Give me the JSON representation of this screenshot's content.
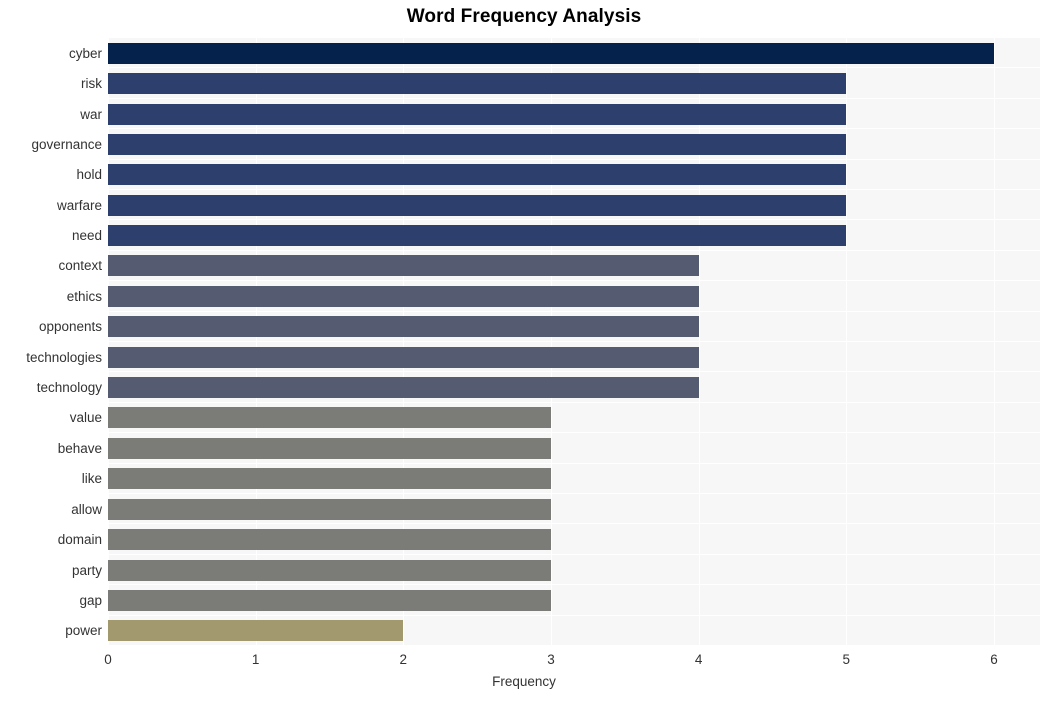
{
  "chart_data": {
    "type": "bar",
    "orientation": "horizontal",
    "title": "Word Frequency Analysis",
    "xlabel": "Frequency",
    "ylabel": "",
    "categories": [
      "cyber",
      "risk",
      "war",
      "governance",
      "hold",
      "warfare",
      "need",
      "context",
      "ethics",
      "opponents",
      "technologies",
      "technology",
      "value",
      "behave",
      "like",
      "allow",
      "domain",
      "party",
      "gap",
      "power"
    ],
    "values": [
      6,
      5,
      5,
      5,
      5,
      5,
      5,
      4,
      4,
      4,
      4,
      4,
      3,
      3,
      3,
      3,
      3,
      3,
      3,
      2
    ],
    "bar_colors": [
      "#04224c",
      "#2d3f6d",
      "#2d3f6d",
      "#2d3f6d",
      "#2d3f6d",
      "#2d3f6d",
      "#2d3f6d",
      "#555b70",
      "#555b70",
      "#555b70",
      "#555b70",
      "#555b70",
      "#7b7b77",
      "#7b7b77",
      "#7b7b77",
      "#7b7b77",
      "#7b7b77",
      "#7b7b77",
      "#7b7b77",
      "#a3996e"
    ],
    "xlim": [
      0,
      6
    ],
    "xticks": [
      0,
      1,
      2,
      3,
      4,
      5,
      6
    ],
    "xtick_labels": [
      "0",
      "1",
      "2",
      "3",
      "4",
      "5",
      "6"
    ],
    "grid": true,
    "grid_color": "#ffffff",
    "panel_background": "#f7f7f7",
    "legend": null
  },
  "style": {
    "title_color": "#000000",
    "tick_label_color": "#333333",
    "figure_background": "#ffffff"
  }
}
